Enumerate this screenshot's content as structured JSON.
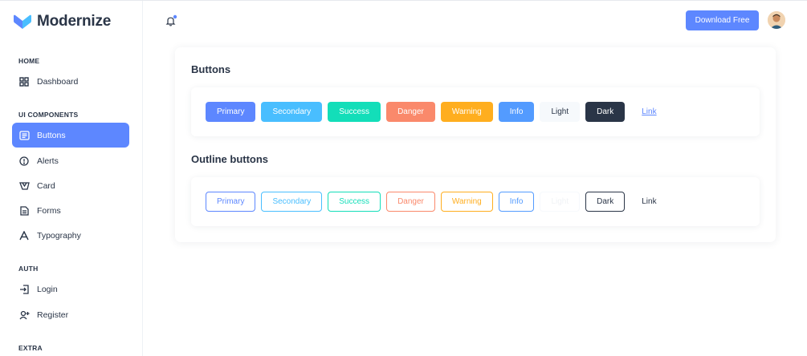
{
  "app": {
    "name": "Modernize"
  },
  "sidebar": {
    "sections": [
      {
        "title": "HOME",
        "items": [
          {
            "label": "Dashboard",
            "icon": "dashboard-icon"
          }
        ]
      },
      {
        "title": "UI COMPONENTS",
        "items": [
          {
            "label": "Buttons",
            "icon": "buttons-icon",
            "active": true
          },
          {
            "label": "Alerts",
            "icon": "alert-circle-icon"
          },
          {
            "label": "Card",
            "icon": "card-icon"
          },
          {
            "label": "Forms",
            "icon": "forms-icon"
          },
          {
            "label": "Typography",
            "icon": "typography-icon"
          }
        ]
      },
      {
        "title": "AUTH",
        "items": [
          {
            "label": "Login",
            "icon": "login-icon"
          },
          {
            "label": "Register",
            "icon": "register-icon"
          }
        ]
      },
      {
        "title": "EXTRA",
        "items": []
      }
    ]
  },
  "header": {
    "download_label": "Download Free"
  },
  "content": {
    "buttons_title": "Buttons",
    "outline_title": "Outline buttons",
    "buttons": [
      "Primary",
      "Secondary",
      "Success",
      "Danger",
      "Warning",
      "Info",
      "Light",
      "Dark",
      "Link"
    ],
    "outline_buttons": [
      "Primary",
      "Secondary",
      "Success",
      "Danger",
      "Warning",
      "Info",
      "Light",
      "Dark",
      "Link"
    ]
  },
  "colors": {
    "primary": "#5d87ff",
    "secondary": "#49beff",
    "success": "#13deb9",
    "danger": "#fa896b",
    "warning": "#ffae1f",
    "info": "#539bff",
    "light": "#f6f9fc",
    "dark": "#2a3547"
  }
}
